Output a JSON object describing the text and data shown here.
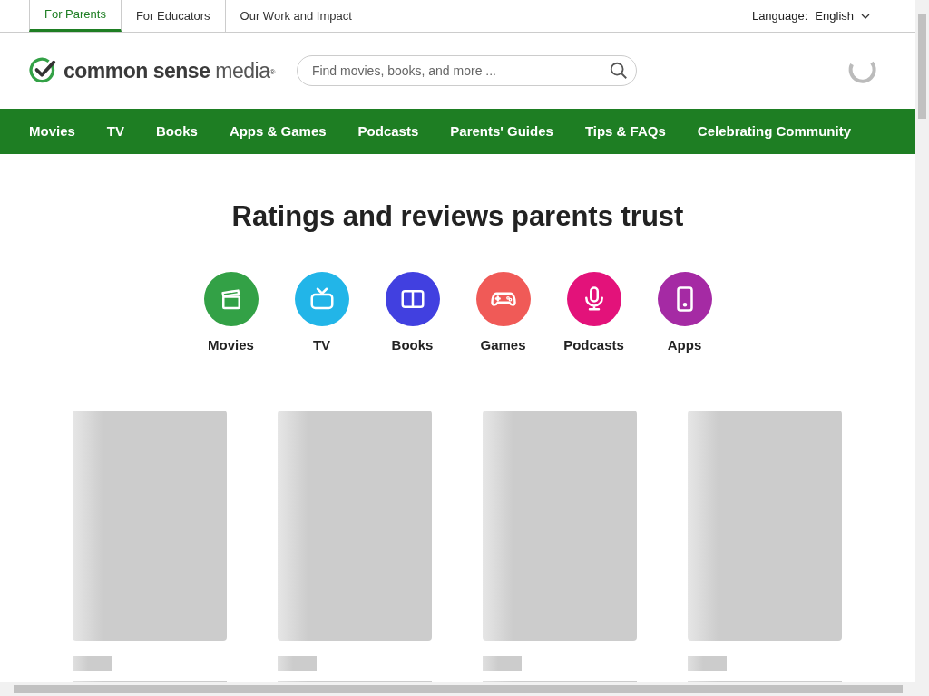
{
  "top_tabs": [
    {
      "label": "For Parents",
      "selected": true
    },
    {
      "label": "For Educators",
      "selected": false
    },
    {
      "label": "Our Work and Impact",
      "selected": false
    }
  ],
  "language": {
    "label": "Language:",
    "value": "English"
  },
  "logo": {
    "bold": "common sense",
    "light": "media",
    "mark": "®"
  },
  "search": {
    "placeholder": "Find movies, books, and more ..."
  },
  "nav": [
    "Movies",
    "TV",
    "Books",
    "Apps & Games",
    "Podcasts",
    "Parents' Guides",
    "Tips & FAQs",
    "Celebrating Community"
  ],
  "heading": "Ratings and reviews parents trust",
  "categories": [
    {
      "label": "Movies",
      "kind": "movie",
      "color": "#33a146"
    },
    {
      "label": "TV",
      "kind": "tv",
      "color": "#22b5e8"
    },
    {
      "label": "Books",
      "kind": "book",
      "color": "#4140e0"
    },
    {
      "label": "Games",
      "kind": "game",
      "color": "#f05a57"
    },
    {
      "label": "Podcasts",
      "kind": "podcast",
      "color": "#e3127a"
    },
    {
      "label": "Apps",
      "kind": "app",
      "color": "#a52aa4"
    }
  ]
}
